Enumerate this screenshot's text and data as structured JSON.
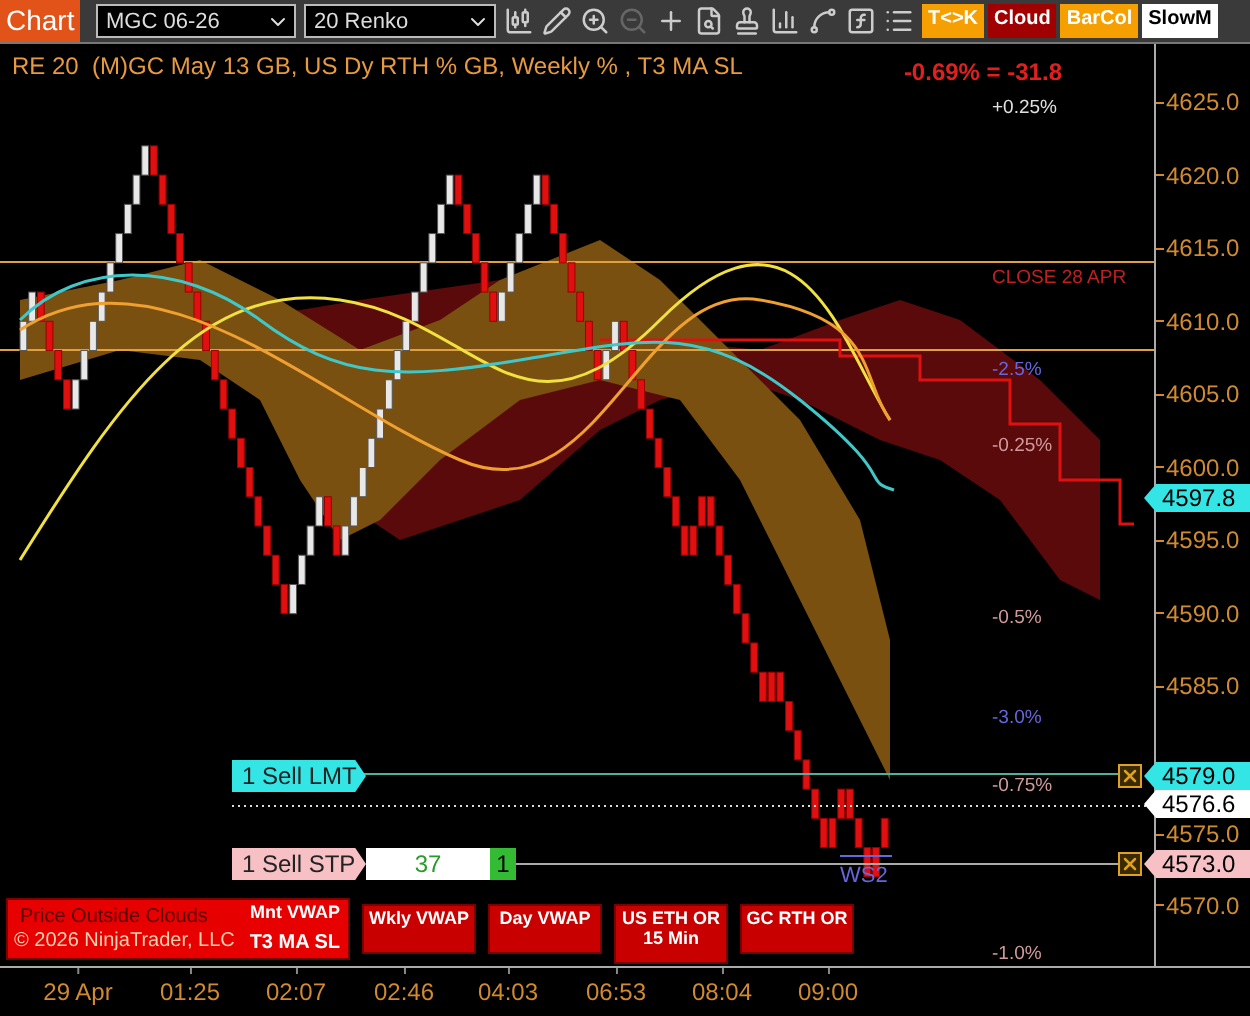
{
  "toolbar": {
    "title": "Chart",
    "instrument": "MGC 06-26",
    "bar_type": "20 Renko",
    "toggles": [
      {
        "label": "T<>K",
        "color": "#f5a000"
      },
      {
        "label": "Cloud",
        "color": "#a00000"
      },
      {
        "label": "BarCol",
        "color": "#f5a000"
      },
      {
        "label": "SlowM",
        "color": "#ffffff"
      }
    ]
  },
  "chart": {
    "header": "RE 20  (M)GC May 13 GB, US Dy RTH % GB, Weekly % , T3 MA SL",
    "change": "-0.69% = -31.8",
    "level_labels": [
      {
        "text": "+0.25%",
        "color": "#e0e0e0"
      },
      {
        "text": "CLOSE 28 APR",
        "color": "#c02020"
      },
      {
        "text": "-2.5%",
        "color": "#6666dd"
      },
      {
        "text": "-0.25%",
        "color": "#d09a9a"
      },
      {
        "text": "-0.5%",
        "color": "#d09a9a"
      },
      {
        "text": "-3.0%",
        "color": "#6666dd"
      },
      {
        "text": "-0.75%",
        "color": "#d09a9a"
      },
      {
        "text": "-1.0%",
        "color": "#d09a9a"
      }
    ],
    "pivot_label": "WS2",
    "orders": [
      {
        "kind": "limit",
        "label": "1 Sell LMT"
      },
      {
        "kind": "stop",
        "label": "1 Sell STP",
        "quantity": "37",
        "count": "1"
      }
    ],
    "indicator_buttons": [
      {
        "label": "Mnt VWAP",
        "sub_label": "T3 MA SL"
      },
      {
        "label": "Wkly VWAP"
      },
      {
        "label": "Day VWAP"
      },
      {
        "label": "US ETH OR 15 Min"
      },
      {
        "label": "GC RTH OR"
      }
    ],
    "watermarks": [
      "Price Outside Clouds",
      "© 2026 NinjaTrader, LLC"
    ]
  },
  "price_axis": {
    "ticks": [
      "4625.0",
      "4620.0",
      "4615.0",
      "4610.0",
      "4605.0",
      "4600.0",
      "4595.0",
      "4590.0",
      "4585.0",
      "4575.0",
      "4570.0"
    ],
    "tags": [
      {
        "text": "4597.8",
        "color": "#33e5e5"
      },
      {
        "text": "4579.0",
        "color": "#33e5e5"
      },
      {
        "text": "4576.6",
        "color": "#ffffff"
      },
      {
        "text": "4573.0",
        "color": "#f6c0c4"
      }
    ]
  },
  "time_axis": [
    "29 Apr",
    "01:25",
    "02:07",
    "02:46",
    "04:03",
    "06:53",
    "08:04",
    "09:00"
  ]
}
